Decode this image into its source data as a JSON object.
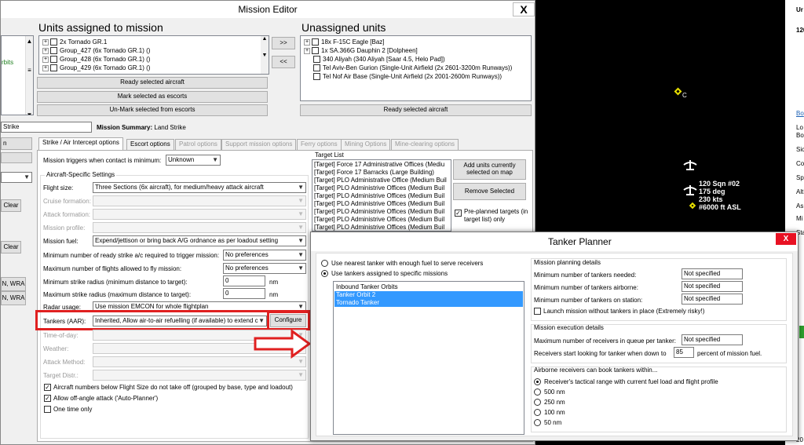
{
  "mission_editor": {
    "title": "Mission Editor",
    "close": "X",
    "assigned_header": "Units assigned to mission",
    "unassigned_header": "Unassigned units",
    "assigned_items": [
      "2x Tornado GR.1",
      "Group_427 (6x Tornado GR.1) ()",
      "Group_428 (6x Tornado GR.1) ()",
      "Group_429 (6x Tornado GR.1) ()"
    ],
    "unassigned_items": [
      "18x F-15C Eagle [Baz]",
      "1x SA.366G Dauphin 2 [Dolpheen]",
      "340 Aliyah (340 Aliyah [Saar 4.5, Helo Pad])",
      "Tel Aviv-Ben Gurion (Single-Unit Airfield (2x 2601-3200m Runways))",
      "Tel Nof Air Base (Single-Unit Airfield (2x 2001-2600m Runways))"
    ],
    "move_right": ">>",
    "move_left": "<<",
    "ready_selected": "Ready selected aircraft",
    "mark_escorts": "Mark selected as escorts",
    "unmark_escorts": "Un-Mark selected from escorts",
    "ready_selected_right": "Ready selected aircraft",
    "left_panel": {
      "orbits": "rbits",
      "mission_name": "Strike",
      "btn1": "n",
      "btn2": "Clear",
      "btn3": "Clear",
      "wra1": "N, WRA",
      "wra2": "N, WRA"
    },
    "mission_summary_label": "Mission Summary:",
    "mission_summary_value": "Land Strike",
    "tabs": [
      "Strike / Air Intercept options",
      "Escort options",
      "Patrol options",
      "Support mission options",
      "Ferry options",
      "Mining Options",
      "Mine-clearing options"
    ],
    "triggers_label": "Mission triggers when contact is minimum:",
    "triggers_value": "Unknown",
    "aircraft_settings": "Aircraft-Specific Settings",
    "fields": [
      {
        "label": "Flight size:",
        "value": "Three Sections (6x aircraft), for medium/heavy attack aircraft",
        "enabled": true
      },
      {
        "label": "Cruise formation:",
        "value": "",
        "enabled": false
      },
      {
        "label": "Attack formation:",
        "value": "",
        "enabled": false
      },
      {
        "label": "Mission profile:",
        "value": "",
        "enabled": false
      },
      {
        "label": "Mission fuel:",
        "value": "Expend/jettison or bring back A/G ordnance as per loadout setting",
        "enabled": true
      }
    ],
    "min_ready_label": "Minimum number of ready strike a/c required to trigger mission:",
    "min_ready_value": "No preferences",
    "max_flights_label": "Maximum number of flights allowed to fly mission:",
    "max_flights_value": "No preferences",
    "min_radius_label": "Minimum strike radius (minimum distance to target):",
    "min_radius_value": "0",
    "max_radius_label": "Maximum strike radius (maximum distance to target):",
    "max_radius_value": "0",
    "nm": "nm",
    "radar_label": "Radar usage:",
    "radar_value": "Use mission EMCON for whole flightplan",
    "tankers_label": "Tankers (AAR):",
    "tankers_value": "Inherited, Allow air-to-air refuelling (if available) to extend c",
    "configure": "Configure",
    "disabled_fields": [
      "Time-of-day:",
      "Weather:",
      "Attack Method:",
      "Target Distr.:"
    ],
    "checks": [
      {
        "label": "Aircraft numbers below Flight Size do not take off (grouped by base, type and loadout)",
        "checked": true
      },
      {
        "label": "Allow off-angle attack ('Auto-Planner')",
        "checked": true
      },
      {
        "label": "One time only",
        "checked": false
      }
    ],
    "target_list_header": "Target List",
    "targets": [
      "[Target] Force 17 Administrative Offices (Mediu",
      "[Target] Force 17 Barracks (Large Building)",
      "[Target] PLO Administrative Office (Medium Buil",
      "[Target] PLO Administrive Offices (Medium Buil",
      "[Target] PLO Administrive Offices (Medium Buil",
      "[Target] PLO Administrive Offices (Medium Buil",
      "[Target] PLO Administrive Offices (Medium Buil",
      "[Target] PLO Administrive Offices (Medium Buil",
      "[Target] PLO Administrive Offices (Medium Buil"
    ],
    "add_units": "Add units currently selected on map",
    "remove_selected": "Remove Selected",
    "preplanned": "Pre-planned targets (in target list) only"
  },
  "tanker_planner": {
    "title": "Tanker Planner",
    "close": "X",
    "radio_nearest": "Use nearest tanker with enough fuel to serve receivers",
    "radio_assigned": "Use tankers assigned to specific missions",
    "missions": [
      "Inbound Tanker Orbits",
      "Tanker Orbit 2",
      "Tornado Tanker"
    ],
    "planning_header": "Mission planning details",
    "planning_rows": [
      {
        "label": "Minimum number of tankers needed:",
        "value": "Not specified"
      },
      {
        "label": "Minimum number of tankers airborne:",
        "value": "Not specified"
      },
      {
        "label": "Minimum number of tankers on station:",
        "value": "Not specified"
      }
    ],
    "launch_without": "Launch mission without tankers in place (Extremely risky!)",
    "execution_header": "Mission execution details",
    "max_receivers_label": "Maximum number of receivers in queue per tanker:",
    "max_receivers_value": "Not specified",
    "receivers_start_label": "Receivers start looking for tanker when down to",
    "receivers_start_value": "85",
    "receivers_start_suffix": "percent of mission fuel.",
    "range_header": "Airborne receivers can book tankers within...",
    "range_options": [
      "Receiver's tactical range with current fuel load and flight profile",
      "500 nm",
      "250 nm",
      "100 nm",
      "50 nm"
    ]
  },
  "map": {
    "label_c": "C",
    "unit_lines": [
      "120 Sqn #02",
      "175 deg",
      "230 kts",
      "6000 ft ASL"
    ],
    "unit_prefix": "#"
  },
  "right_panel": {
    "top": "Ur",
    "num": "120",
    "items": [
      "Bo",
      "Lo",
      "Bo",
      "Sic",
      "Co",
      "Sp",
      "Alt",
      "As",
      "Mi",
      "Sta"
    ],
    "bottom": "20"
  },
  "colors": {
    "red": "#e02020",
    "select": "#3399ff",
    "map": "#000000",
    "green_text": "#208020"
  }
}
